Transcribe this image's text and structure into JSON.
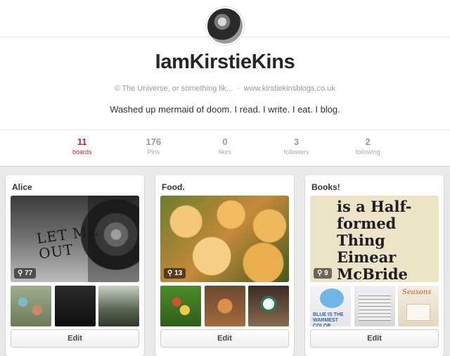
{
  "profile": {
    "name": "IamKirstieKins",
    "location": "The Universe, or something lik...",
    "separator": "·",
    "website": "www.kirstiekinsblogs.co.uk",
    "bio": "Washed up mermaid of doom. I read. I write. I eat. I blog.",
    "avatar_icon": "avatar-photo"
  },
  "stats": [
    {
      "value": "11",
      "label": "boards",
      "active": true
    },
    {
      "value": "176",
      "label": "Pins"
    },
    {
      "value": "0",
      "label": "likes"
    },
    {
      "value": "3",
      "label": "followers"
    },
    {
      "value": "2",
      "label": "following"
    }
  ],
  "colors": {
    "accent": "#cb2027",
    "stat_muted": "#999999",
    "background": "#e9e9e9"
  },
  "boards": [
    {
      "title": "Alice",
      "pin_count": "77",
      "cover_text": "LET ME OUT",
      "edit_label": "Edit"
    },
    {
      "title": "Food.",
      "pin_count": "13",
      "edit_label": "Edit"
    },
    {
      "title": "Books!",
      "pin_count": "9",
      "cover_text": "is a Half-formed Thing Eimear McBride",
      "thumb_blue_label": "BLUE IS THE WARMEST COLOR",
      "thumb_script": "Seasons",
      "edit_label": "Edit"
    }
  ],
  "icons": {
    "pin": "pushpin-icon",
    "location": "copyright-icon"
  }
}
